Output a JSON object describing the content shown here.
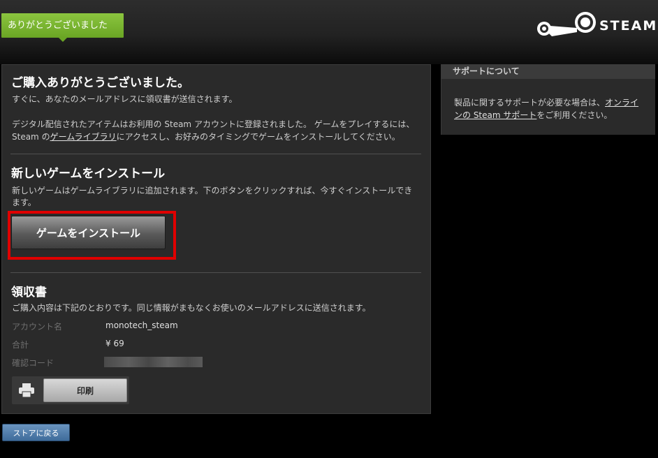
{
  "header": {
    "tag_label": "ありがとうございました",
    "logo_text": "STEAM"
  },
  "main": {
    "title": "ご購入ありがとうございました。",
    "email_notice": "すぐに、あなたのメールアドレスに領収書が送信されます。",
    "registered_text": "デジタル配信されたアイテムはお利用の Steam アカウントに登録されました。 ゲームをプレイするには、",
    "library_prefix": "Steam の",
    "library_link": "ゲームライブラリ",
    "library_suffix": "にアクセスし、お好みのタイミングでゲームをインストールしてください。",
    "install_title": "新しいゲームをインストール",
    "install_desc_line1": "新しいゲームはゲームライブラリに追加されます。下のボタンをクリックすれば、今すぐインストールでき",
    "install_desc_line2": "ます。",
    "install_button": "ゲームをインストール",
    "receipt_title": "領収書",
    "receipt_desc": "ご購入内容は下記のとおりです。同じ情報がまもなくお使いのメールアドレスに送信されます。",
    "receipt_rows": [
      {
        "label": "アカウント名",
        "value": "monotech_steam"
      },
      {
        "label": "合計",
        "value": "¥ 69"
      },
      {
        "label": "確認コード",
        "value": ""
      }
    ],
    "print_button": "印刷"
  },
  "sidebar": {
    "heading": "サポートについて",
    "text_prefix": "製品に関するサポートが必要な場合は、",
    "link_line1": "オンライ",
    "link_line2": "ンの Steam サポート",
    "text_suffix": "をご利用ください。"
  },
  "footer": {
    "back_button": "ストアに戻る"
  },
  "colors": {
    "accent_green": "#6aa524",
    "highlight_red": "#e00000",
    "back_button_blue": "#3e6b9a"
  }
}
